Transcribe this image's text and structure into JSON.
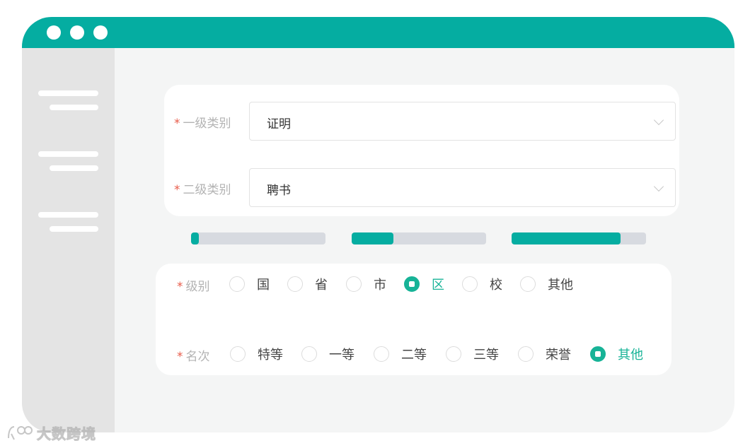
{
  "form": {
    "primary_category": {
      "label": "一级类别",
      "value": "证明"
    },
    "secondary_category": {
      "label": "二级类别",
      "value": "聘书"
    }
  },
  "progress": [
    0.06,
    0.31,
    0.81
  ],
  "level": {
    "label": "级别",
    "options": [
      "国",
      "省",
      "市",
      "区",
      "校",
      "其他"
    ],
    "selected": "区"
  },
  "rank": {
    "label": "名次",
    "options": [
      "特等",
      "一等",
      "二等",
      "三等",
      "荣誉",
      "其他"
    ],
    "selected": "其他"
  },
  "watermark": "大数跨境",
  "colors": {
    "accent": "#05ada1",
    "selected": "#17b397",
    "required": "#e85c4a"
  }
}
